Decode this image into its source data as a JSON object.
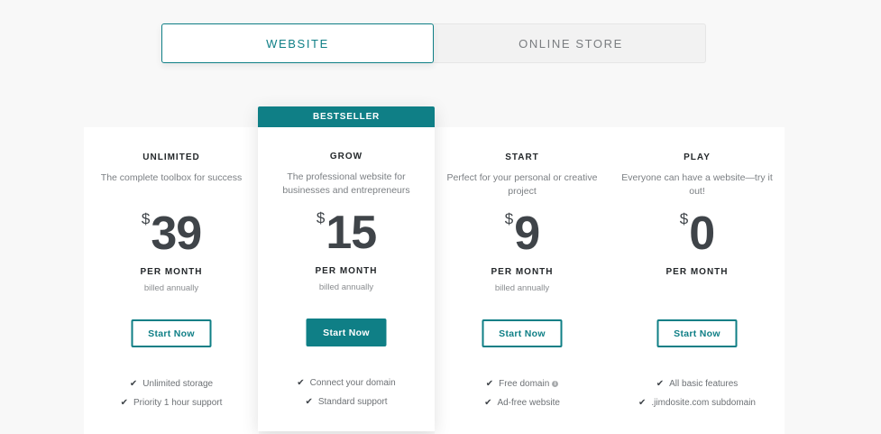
{
  "toggle": {
    "website_label": "WEBSITE",
    "store_label": "ONLINE STORE"
  },
  "ribbon": "BESTSELLER",
  "plans": [
    {
      "name": "UNLIMITED",
      "description": "The complete toolbox for success",
      "currency": "$",
      "price": "39",
      "per": "PER MONTH",
      "billed": "billed annually",
      "cta": "Start Now",
      "features": [
        "Unlimited storage",
        "Priority 1 hour support"
      ]
    },
    {
      "name": "GROW",
      "description": "The professional website for businesses and entrepreneurs",
      "currency": "$",
      "price": "15",
      "per": "PER MONTH",
      "billed": "billed annually",
      "cta": "Start Now",
      "features": [
        "Connect your domain",
        "Standard support"
      ]
    },
    {
      "name": "START",
      "description": "Perfect for your personal or creative project",
      "currency": "$",
      "price": "9",
      "per": "PER MONTH",
      "billed": "billed annually",
      "cta": "Start Now",
      "features": [
        "Free domain",
        "Ad-free website"
      ]
    },
    {
      "name": "PLAY",
      "description": "Everyone can have a website—try it out!",
      "currency": "$",
      "price": "0",
      "per": "PER MONTH",
      "billed": "",
      "cta": "Start Now",
      "features": [
        "All basic features",
        ".jimdosite.com subdomain"
      ]
    }
  ],
  "icons": {
    "check": "check-icon",
    "info": "info-icon"
  },
  "colors": {
    "accent": "#0f7f86",
    "background": "#f8f8f8",
    "card": "#ffffff"
  }
}
